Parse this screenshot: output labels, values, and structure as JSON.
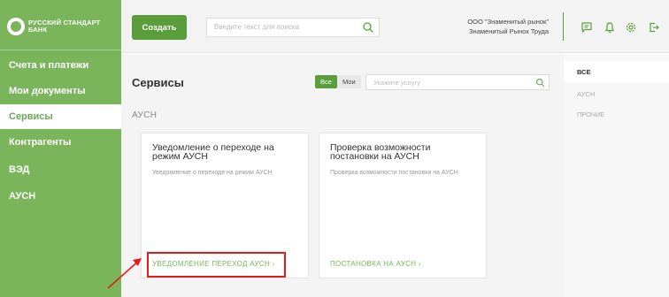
{
  "brand": {
    "name_line1": "РУССКИЙ СТАНДАРТ",
    "name_line2": "БАНК"
  },
  "sidebar": {
    "items": [
      {
        "label": "Счета и платежи"
      },
      {
        "label": "Мои документы"
      },
      {
        "label": "Сервисы",
        "active": true
      },
      {
        "label": "Контрагенты"
      },
      {
        "label": "ВЭД"
      },
      {
        "label": "АУСН"
      }
    ]
  },
  "header": {
    "create_label": "Создать",
    "search_placeholder": "Введите текст для поиска",
    "org_name": "ООО \"Знаменитый рынок\"",
    "org_user": "Знаменитый Рынок Труда",
    "icons": [
      "chat-icon",
      "bell-icon",
      "gear-icon",
      "logout-icon"
    ]
  },
  "main": {
    "title": "Сервисы",
    "filter": {
      "all_label": "Все",
      "mine_label": "Мои",
      "selected": "Все"
    },
    "search_placeholder": "Укажите услугу",
    "section_label": "АУСН",
    "cards": [
      {
        "title": "Уведомление о переходе на режим АУСН",
        "description": "Уведомление о переходе на режим АУСН",
        "link": "УВЕДОМЛЕНИЕ ПЕРЕХОД АУСН ›"
      },
      {
        "title": "Проверка возможности постановки на АУСН",
        "description": "Проверка возможности постановки на АУСН",
        "link": "ПОСТАНОВКА НА АУСН ›"
      }
    ]
  },
  "right_panel": {
    "items": [
      {
        "label": "ВСЕ",
        "active": true
      },
      {
        "label": "АУСН"
      },
      {
        "label": "ПРОЧИЕ"
      }
    ]
  },
  "colors": {
    "brand_green": "#7ab55c",
    "button_green": "#5a9e3c",
    "highlight_red": "#e21b1b"
  }
}
